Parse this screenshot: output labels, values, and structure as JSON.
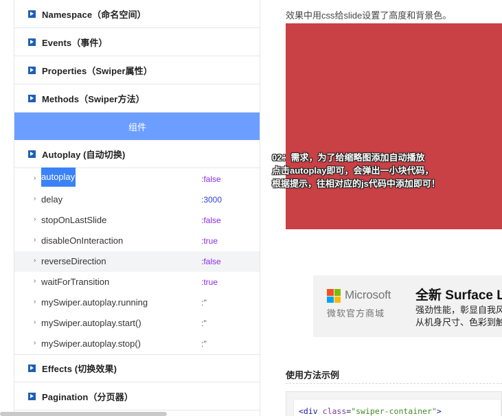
{
  "sidebar": {
    "sections_top": [
      {
        "label": "Namespace（命名空间）"
      },
      {
        "label": "Events（事件）"
      },
      {
        "label": "Properties（Swiper属性）"
      },
      {
        "label": "Methods（Swiper方法）"
      }
    ],
    "group_label": "组件",
    "autoplay_section": {
      "label": "Autoplay (自动切换)"
    },
    "autoplay_items": [
      {
        "name": "autoplay",
        "value": ":false"
      },
      {
        "name": "delay",
        "value": ":3000"
      },
      {
        "name": "stopOnLastSlide",
        "value": ":false"
      },
      {
        "name": "disableOnInteraction",
        "value": ":true"
      },
      {
        "name": "reverseDirection",
        "value": ":false"
      },
      {
        "name": "waitForTransition",
        "value": ":true"
      },
      {
        "name": "mySwiper.autoplay.running",
        "value": ":''"
      },
      {
        "name": "mySwiper.autoplay.start()",
        "value": ":''"
      },
      {
        "name": "mySwiper.autoplay.stop()",
        "value": ":''"
      }
    ],
    "sections_bottom": [
      {
        "label": "Effects (切换效果)"
      },
      {
        "label": "Pagination（分页器）"
      }
    ],
    "selected_item": "autoplay",
    "highlighted_item": "reverseDirection"
  },
  "content": {
    "intro_text": "效果中用css给slide设置了高度和背景色。",
    "slide_color": "#c94045",
    "annotation_lines": [
      "02：需求，为了给缩略图添加自动播放",
      "点击autoplay即可，会弹出一小块代码，",
      "根据提示，往相对应的js代码中添加即可！"
    ],
    "ad": {
      "brand": "Microsoft",
      "store": "微软官方商城",
      "title": "全新 Surface L",
      "line1": "强劲性能，彰显自我风",
      "line2": "从机身尺寸、色彩到触"
    },
    "usage_title": "使用方法示例",
    "code": {
      "tag_open": "<div",
      "attr": "class",
      "eq": "=",
      "value": "\"swiper-container\"",
      "tag_close": ">"
    }
  },
  "colors": {
    "accent_bar": "#6b9eff",
    "section_icon": "#1f5fb4",
    "value_false": "#8a2be2",
    "value_number": "#3344cc",
    "ms_red": "#f25022",
    "ms_green": "#7fba00",
    "ms_blue": "#00a4ef",
    "ms_yellow": "#ffb900"
  }
}
